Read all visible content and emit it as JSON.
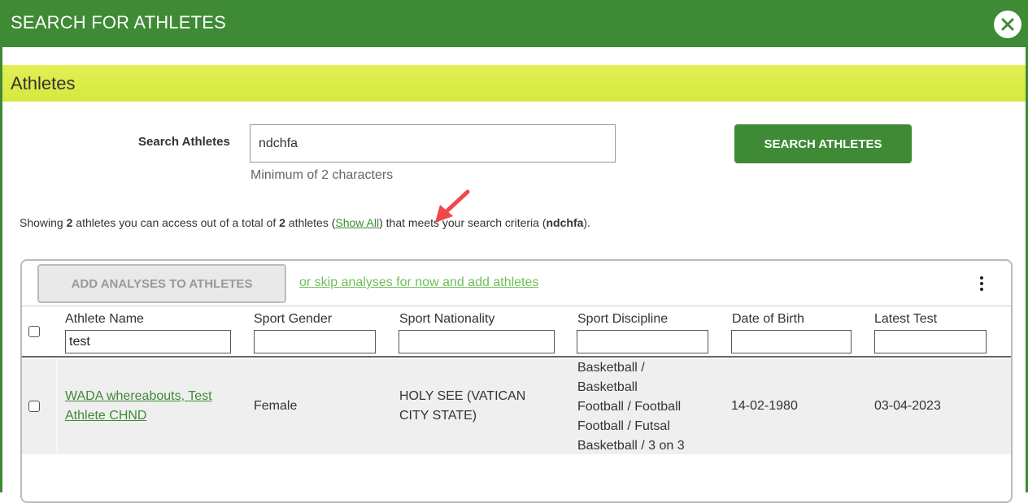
{
  "dialog": {
    "title": "SEARCH FOR ATHLETES",
    "close_icon": "close-icon"
  },
  "section": {
    "title": "Athletes"
  },
  "search": {
    "label": "Search Athletes",
    "value": "ndchfa",
    "hint": "Minimum of 2 characters",
    "button_label": "SEARCH ATHLETES"
  },
  "summary": {
    "prefix": "Showing ",
    "shown_count": "2",
    "middle": " athletes you can access out of a total of ",
    "total_count": "2",
    "after_total": " athletes (",
    "show_all_label": "Show All",
    "after_link": ") that meets your search criteria (",
    "criteria": "ndchfa",
    "suffix": ")."
  },
  "toolbar": {
    "add_analyses_label": "ADD ANALYSES TO ATHLETES",
    "skip_link_label": "or skip analyses for now and add athletes"
  },
  "table": {
    "columns": [
      {
        "title": "Athlete Name",
        "filter": "test"
      },
      {
        "title": "Sport Gender",
        "filter": ""
      },
      {
        "title": "Sport Nationality",
        "filter": ""
      },
      {
        "title": "Sport Discipline",
        "filter": ""
      },
      {
        "title": "Date of Birth",
        "filter": ""
      },
      {
        "title": "Latest Test",
        "filter": ""
      }
    ],
    "rows": [
      {
        "name_line1": "WADA whereabouts, Test",
        "name_line2": "Athlete CHND",
        "gender": "Female",
        "nationality_line1": "HOLY SEE (VATICAN",
        "nationality_line2": "CITY STATE)",
        "discipline": [
          "Basketball /",
          "Basketball",
          "Football / Football",
          "Football / Futsal",
          "Basketball / 3 on 3"
        ],
        "date_of_birth": "14-02-1980",
        "latest_test": "03-04-2023"
      }
    ]
  },
  "colors": {
    "brand_green": "#3e8a35",
    "band_yellow": "#d9eb45",
    "link_light_green": "#6fbf5a",
    "annotation_red": "#f04848"
  }
}
